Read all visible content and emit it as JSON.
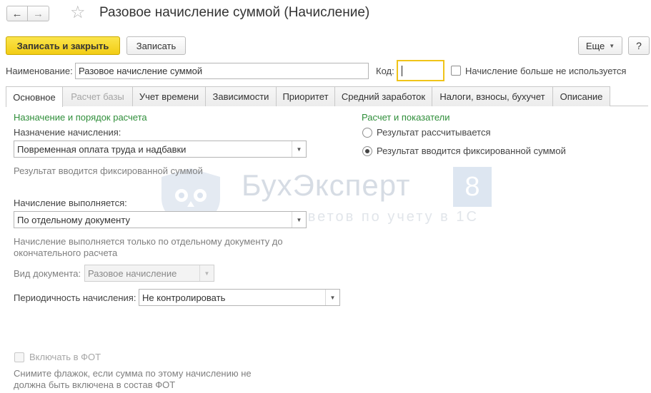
{
  "header": {
    "title": "Разовое начисление суммой (Начисление)",
    "back_icon": "arrow-left-icon",
    "forward_icon": "arrow-right-icon",
    "favorite_icon": "star-icon"
  },
  "toolbar": {
    "save_close_label": "Записать и закрыть",
    "save_label": "Записать",
    "more_label": "Еще",
    "help_label": "?"
  },
  "name_row": {
    "name_label": "Наименование:",
    "name_value": "Разовое начисление суммой",
    "code_label": "Код:",
    "code_value": "",
    "unused_label": "Начисление больше не используется",
    "unused_checked": false
  },
  "tabs": [
    {
      "label": "Основное",
      "active": true
    },
    {
      "label": "Расчет базы",
      "disabled": true
    },
    {
      "label": "Учет времени"
    },
    {
      "label": "Зависимости"
    },
    {
      "label": "Приоритет"
    },
    {
      "label": "Средний заработок"
    },
    {
      "label": "Налоги, взносы, бухучет"
    },
    {
      "label": "Описание"
    }
  ],
  "left": {
    "group_title": "Назначение и порядок расчета",
    "purpose_label": "Назначение начисления:",
    "purpose_value": "Повременная оплата труда и надбавки",
    "purpose_hint": "Результат вводится фиксированной суммой",
    "performed_label": "Начисление выполняется:",
    "performed_value": "По отдельному документу",
    "performed_hint_line1": "Начисление выполняется только по отдельному документу до",
    "performed_hint_line2": "окончательного расчета",
    "doc_type_label": "Вид документа:",
    "doc_type_value": "Разовое начисление",
    "periodicity_label": "Периодичность начисления:",
    "periodicity_value": "Не контролировать",
    "fot_label": "Включать в ФОТ",
    "fot_checked": false,
    "fot_hint_line1": "Снимите флажок, если сумма по этому начислению не",
    "fot_hint_line2": "должна быть включена в состав ФОТ"
  },
  "right": {
    "group_title": "Расчет и показатели",
    "radio_calculated": "Результат рассчитывается",
    "radio_fixed": "Результат вводится фиксированной суммой",
    "selected": "fixed"
  },
  "watermark": {
    "brand": "БухЭксперт",
    "number": "8",
    "tagline": "База ответов по учету в 1С"
  },
  "colors": {
    "accent_yellow": "#f2cd15",
    "group_green": "#2f8e3a",
    "focus_border": "#f0c419"
  }
}
